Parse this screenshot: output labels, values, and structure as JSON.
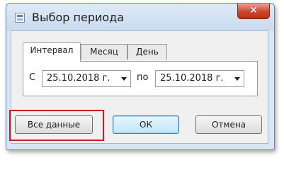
{
  "window": {
    "title": "Выбор периода",
    "close_label": "✕"
  },
  "tabs": [
    {
      "label": "Интервал",
      "active": true
    },
    {
      "label": "Месяц",
      "active": false
    },
    {
      "label": "День",
      "active": false
    }
  ],
  "interval": {
    "from_label": "С",
    "from_value": "25.10.2018 г.",
    "to_label": "по",
    "to_value": "25.10.2018 г."
  },
  "buttons": {
    "all_data": "Все данные",
    "ok": "ОК",
    "cancel": "Отмена"
  },
  "colors": {
    "highlight": "#c0202a",
    "titlebar": "#c9dbef",
    "close_button": "#c9452c"
  }
}
